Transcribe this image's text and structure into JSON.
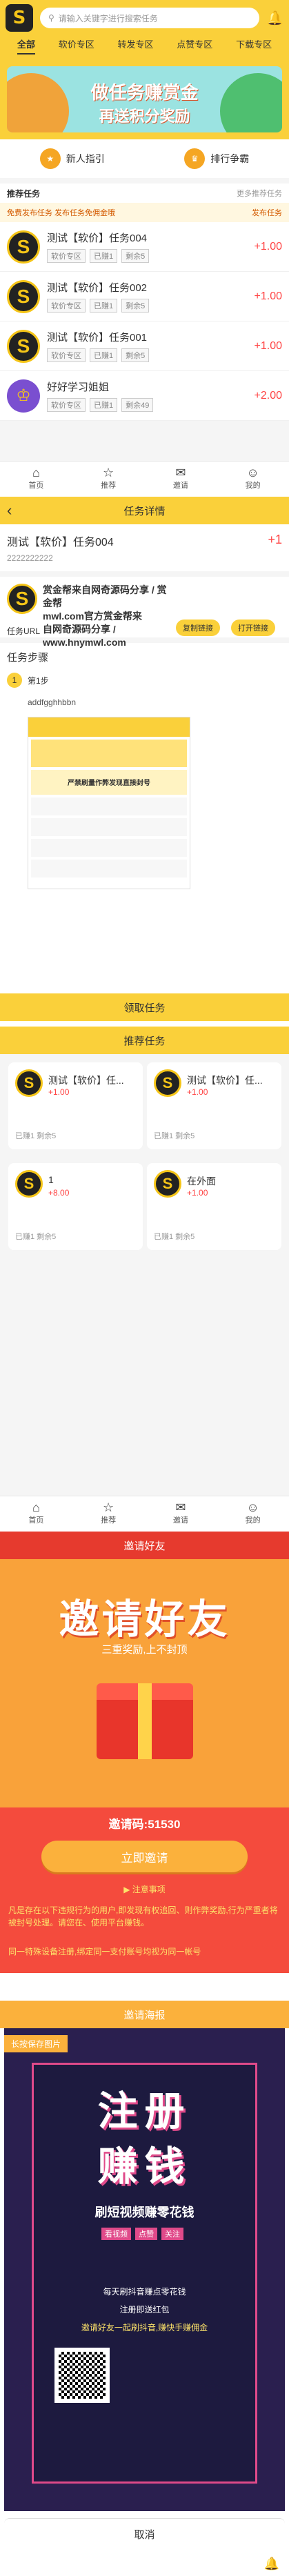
{
  "home": {
    "logo": "S",
    "search_placeholder": "请输入关键字进行搜索任务",
    "tabs": [
      "全部",
      "软价专区",
      "转发专区",
      "点赞专区",
      "下载专区"
    ],
    "banner": {
      "line1": "做任务赚赏金",
      "line2": "再送积分奖励"
    },
    "menu": [
      {
        "label": "新人指引"
      },
      {
        "label": "排行争霸"
      }
    ],
    "rec_title": "推荐任务",
    "rec_more": "更多推荐任务",
    "notice": "免费发布任务 发布任务免佣金哦",
    "notice_link": "发布任务",
    "tasks": [
      {
        "title": "测试【软价】任务004",
        "tags": [
          "软价专区",
          "已赚1",
          "剩余5"
        ],
        "reward": "+1.00"
      },
      {
        "title": "测试【软价】任务002",
        "tags": [
          "软价专区",
          "已赚1",
          "剩余5"
        ],
        "reward": "+1.00"
      },
      {
        "title": "测试【软价】任务001",
        "tags": [
          "软价专区",
          "已赚1",
          "剩余5"
        ],
        "reward": "+1.00"
      },
      {
        "title": "好好学习姐姐",
        "tags": [
          "软价专区",
          "已赚1",
          "剩余49"
        ],
        "reward": "+2.00"
      }
    ],
    "nav": [
      "首页",
      "推荐",
      "邀请",
      "我的"
    ]
  },
  "detail": {
    "header": "任务详情",
    "title": "测试【软价】任务004",
    "reward": "+1",
    "desc": "2222222222",
    "promo_title": "赏金帮来自网奇源码分享 / 赏金帮",
    "promo_l2": "mwl.com官方赏金帮来",
    "promo_l3": "自网奇源码分享 / www.hnymwl.com",
    "btn_copy": "复制链接",
    "btn_open": "打开链接",
    "url_label": "任务URL",
    "steps_title": "任务步骤",
    "step1": "第1步",
    "step1_text": "addfgghhbbn",
    "img_caption": "严禁刷量作弊发现直接封号",
    "accept_btn": "领取任务",
    "rec_title": "推荐任务",
    "rec": [
      {
        "title": "测试【软价】任...",
        "price": "+1.00",
        "stats": "已赚1 剩余5"
      },
      {
        "title": "测试【软价】任...",
        "price": "+1.00",
        "stats": "已赚1 剩余5"
      },
      {
        "title": "1",
        "price": "+8.00",
        "stats": "已赚1 剩余5"
      },
      {
        "title": "在外面",
        "price": "+1.00",
        "stats": "已赚1 剩余5"
      }
    ],
    "nav": [
      "首页",
      "推荐",
      "邀请",
      "我的"
    ]
  },
  "invite": {
    "header": "邀请好友",
    "big": "邀请好友",
    "sub": "三重奖励,上不封顶",
    "code_label": "邀请码:",
    "code": "51530",
    "btn": "立即邀请",
    "notes_title": "注意事项",
    "note1": "凡是存在以下违规行为的用户,即发现有权追回、则作弊奖励,行为严重者将被封号处理。请您在、使用平台赚钱。",
    "note2": "同一特殊设备注册,绑定同一支付账号均视为同一帐号"
  },
  "poster": {
    "header": "邀请海报",
    "badge": "长按保存图片",
    "big1": "注册",
    "big2": "赚钱",
    "tagline": "刷短视频赚零花钱",
    "chips": [
      "看视频",
      "点赞",
      "关注"
    ],
    "small1": "每天刷抖音赚点零花钱",
    "small2": "注册即送红包",
    "small3": "邀请好友一起刷抖音,赚快手赚佣金",
    "cancel": "取消"
  }
}
